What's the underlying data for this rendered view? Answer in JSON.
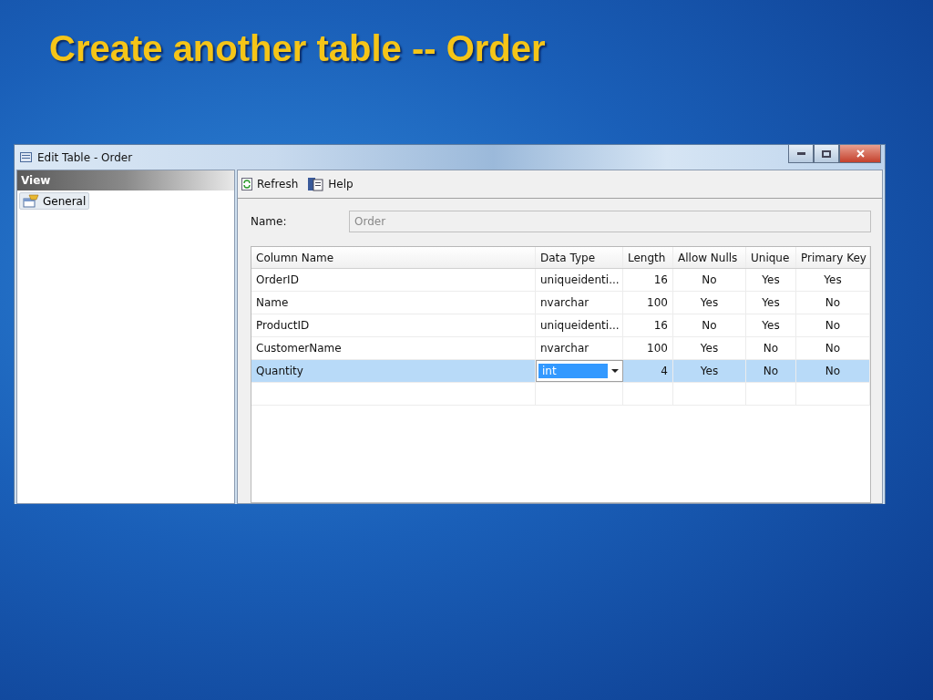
{
  "slide_title": "Create another table -- Order",
  "window": {
    "title": "Edit Table - Order"
  },
  "sidebar": {
    "header": "View",
    "items": [
      {
        "label": "General",
        "selected": true
      }
    ]
  },
  "toolbar": [
    "Refresh",
    "Help"
  ],
  "name_field": {
    "label": "Name:",
    "value": "Order",
    "disabled": true
  },
  "table": {
    "columns": [
      "Column Name",
      "Data Type",
      "Length",
      "Allow Nulls",
      "Unique",
      "Primary Key"
    ],
    "rows": [
      {
        "selected": false,
        "cells": [
          "OrderID",
          "uniqueidenti...",
          "16",
          "No",
          "Yes",
          "Yes"
        ]
      },
      {
        "selected": false,
        "cells": [
          "Name",
          "nvarchar",
          "100",
          "Yes",
          "Yes",
          "No"
        ]
      },
      {
        "selected": false,
        "cells": [
          "ProductID",
          "uniqueidenti...",
          "16",
          "No",
          "Yes",
          "No"
        ]
      },
      {
        "selected": false,
        "cells": [
          "CustomerName",
          "nvarchar",
          "100",
          "Yes",
          "No",
          "No"
        ]
      },
      {
        "selected": true,
        "cells": [
          "Quantity",
          "int",
          "4",
          "Yes",
          "No",
          "No"
        ]
      }
    ]
  }
}
